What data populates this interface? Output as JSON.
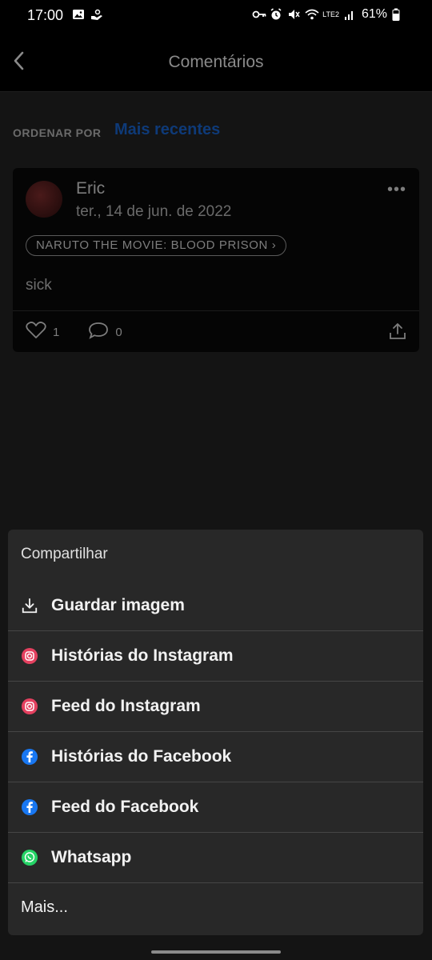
{
  "status_bar": {
    "time": "17:00",
    "battery": "61%",
    "network": "LTE2"
  },
  "header": {
    "title": "Comentários",
    "back_icon": "chevron-left-icon"
  },
  "sort": {
    "label": "ORDENAR POR",
    "value": "Mais recentes"
  },
  "comment": {
    "author": "Eric",
    "date": "ter., 14 de jun. de 2022",
    "tag": "NARUTO THE MOVIE: BLOOD PRISON",
    "text": "sick",
    "likes": "1",
    "replies": "0",
    "more_icon": "more-dots-icon"
  },
  "share_sheet": {
    "title": "Compartilhar",
    "options": [
      {
        "label": "Guardar imagem",
        "icon": "download-icon"
      },
      {
        "label": "Histórias do Instagram",
        "icon": "instagram-icon"
      },
      {
        "label": "Feed do Instagram",
        "icon": "instagram-icon"
      },
      {
        "label": "Histórias do Facebook",
        "icon": "facebook-icon"
      },
      {
        "label": "Feed do Facebook",
        "icon": "facebook-icon"
      },
      {
        "label": "Whatsapp",
        "icon": "whatsapp-icon"
      },
      {
        "label": "Mais...",
        "icon": ""
      }
    ]
  },
  "colors": {
    "accent_blue": "#0e3a78",
    "instagram": "#e4405f",
    "facebook": "#1877f2",
    "whatsapp": "#25d366"
  }
}
